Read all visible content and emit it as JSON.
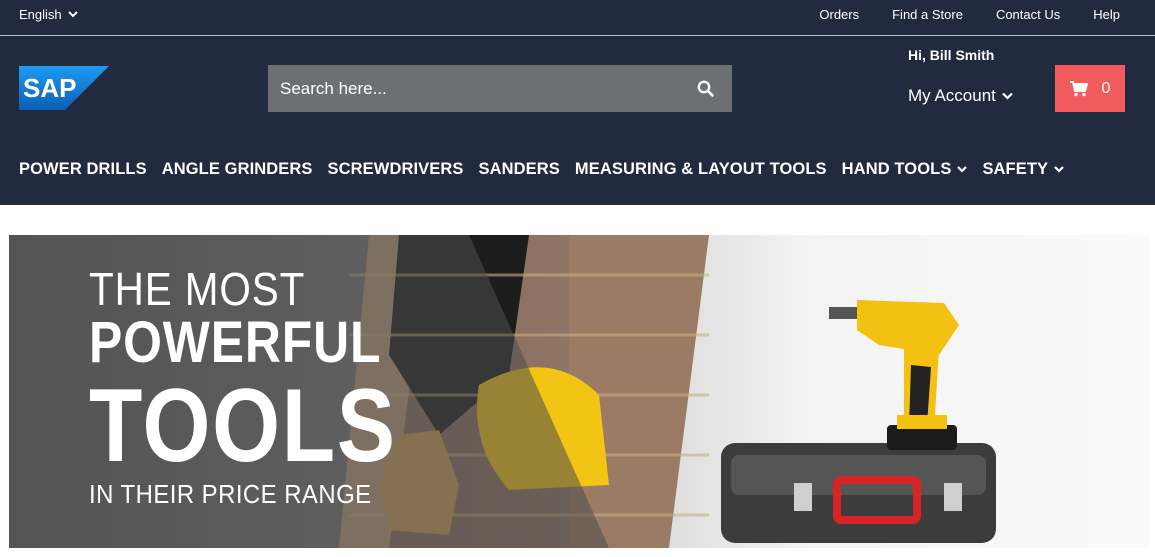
{
  "topbar": {
    "language": "English",
    "links": [
      "Orders",
      "Find a Store",
      "Contact Us",
      "Help"
    ]
  },
  "header": {
    "logo_text": "SAP",
    "search_placeholder": "Search here...",
    "greeting": "Hi, Bill Smith",
    "account_label": "My Account",
    "cart_count": "0"
  },
  "nav": {
    "items": [
      {
        "label": "POWER DRILLS",
        "dropdown": false
      },
      {
        "label": "ANGLE GRINDERS",
        "dropdown": false
      },
      {
        "label": "SCREWDRIVERS",
        "dropdown": false
      },
      {
        "label": "SANDERS",
        "dropdown": false
      },
      {
        "label": "MEASURING & LAYOUT TOOLS",
        "dropdown": false
      },
      {
        "label": "HAND TOOLS",
        "dropdown": true
      },
      {
        "label": "SAFETY",
        "dropdown": true
      }
    ]
  },
  "hero": {
    "line1": "THE MOST",
    "line2": "POWERFUL",
    "line3": "TOOLS",
    "line4": "IN THEIR PRICE RANGE"
  },
  "colors": {
    "header_bg": "#222a3f",
    "cart_bg": "#f25b5b",
    "search_bg": "#6d6f75",
    "logo_blue": "#1a7fd4"
  },
  "icons": [
    "chevron-down-icon",
    "sap-logo",
    "search-icon",
    "cart-icon"
  ]
}
